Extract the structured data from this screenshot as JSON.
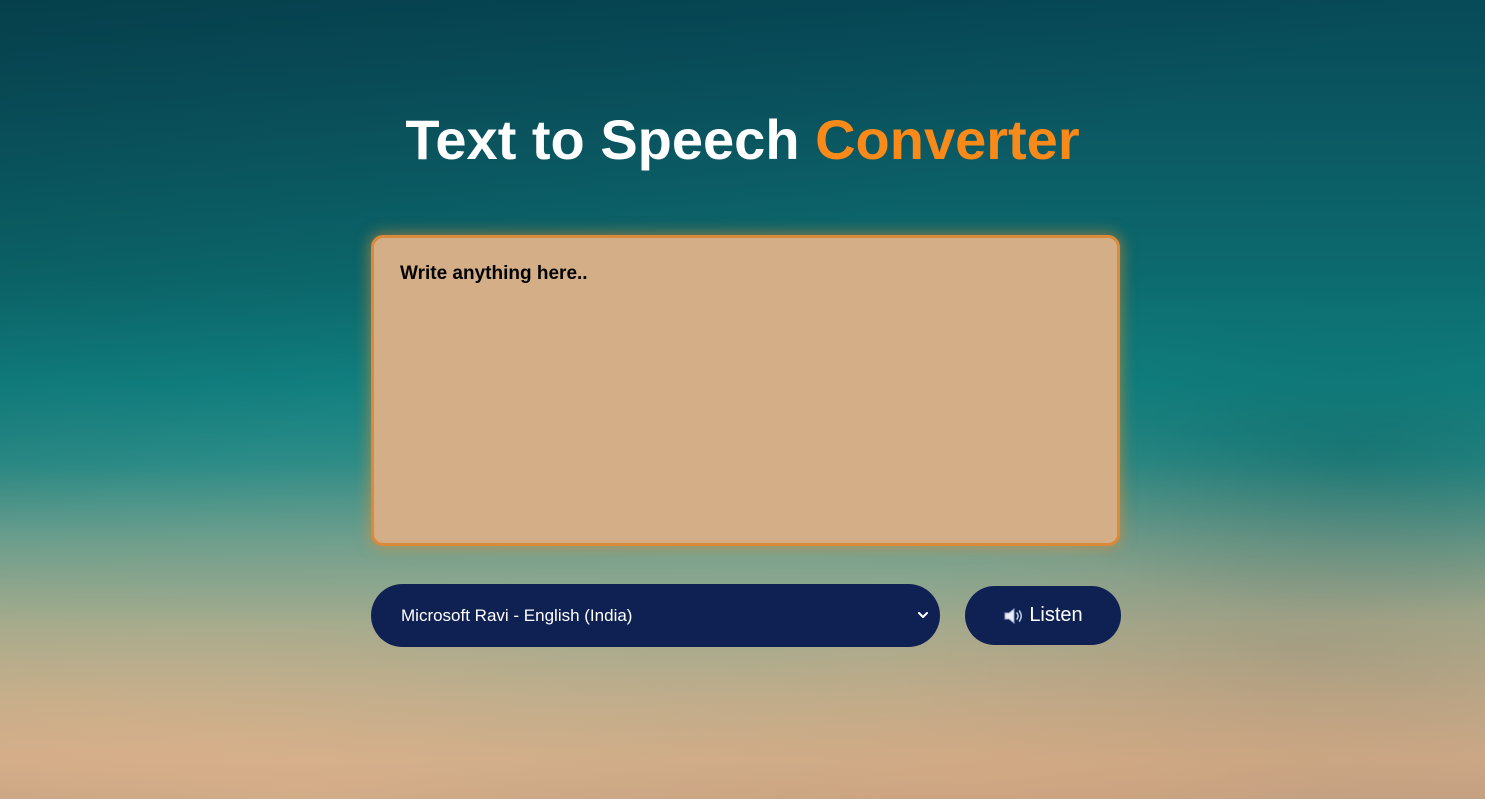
{
  "header": {
    "title_main": "Text to Speech",
    "title_accent": "Converter"
  },
  "editor": {
    "placeholder": "Write anything here..",
    "value": ""
  },
  "voice_select": {
    "selected": "Microsoft Ravi - English (India)"
  },
  "listen_button": {
    "label": "Listen",
    "icon": "speaker-icon"
  },
  "colors": {
    "accent": "#f98a1a",
    "button_bg": "#0f2152",
    "textarea_bg": "#d4ae86",
    "textarea_border": "#d98a3a"
  }
}
